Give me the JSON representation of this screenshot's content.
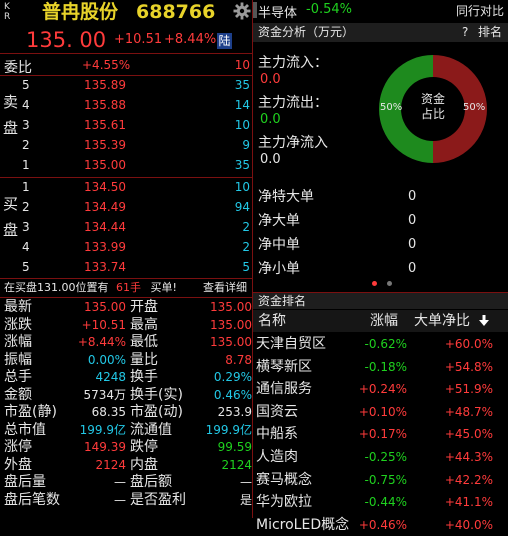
{
  "header": {
    "kr_label": "K\nR",
    "stock_name": "普冉股份",
    "stock_code": "688766",
    "price": "135. 00",
    "change": "+10.51",
    "change_pct": "+8.44%",
    "market_badge": "陆",
    "sector_name": "半导体",
    "sector_change": "-0.54%",
    "compare_label": "同行对比"
  },
  "order_book": {
    "weibi_label": "委比",
    "weibi_pct": "+4.55%",
    "weibi_val": "10",
    "sell_label": "卖\n\n盘",
    "buy_label": "买\n\n盘",
    "sells": [
      {
        "level": "5",
        "price": "135.89",
        "vol": "35"
      },
      {
        "level": "4",
        "price": "135.88",
        "vol": "14"
      },
      {
        "level": "3",
        "price": "135.61",
        "vol": "10"
      },
      {
        "level": "2",
        "price": "135.39",
        "vol": "9"
      },
      {
        "level": "1",
        "price": "135.00",
        "vol": "35"
      }
    ],
    "buys": [
      {
        "level": "1",
        "price": "134.50",
        "vol": "10"
      },
      {
        "level": "2",
        "price": "134.49",
        "vol": "94"
      },
      {
        "level": "3",
        "price": "134.44",
        "vol": "2"
      },
      {
        "level": "4",
        "price": "133.99",
        "vol": "2"
      },
      {
        "level": "5",
        "price": "133.74",
        "vol": "5"
      }
    ],
    "queue_text": "在买盘131.00位置有",
    "queue_qty": "61手",
    "queue_buy": "买单!",
    "queue_detail": "查看详细"
  },
  "quote": [
    {
      "l1": "最新",
      "v1": "135.00",
      "c1": "red",
      "l2": "开盘",
      "v2": "135.00",
      "c2": "red"
    },
    {
      "l1": "涨跌",
      "v1": "+10.51",
      "c1": "red",
      "l2": "最高",
      "v2": "135.00",
      "c2": "red"
    },
    {
      "l1": "涨幅",
      "v1": "+8.44%",
      "c1": "red",
      "l2": "最低",
      "v2": "135.00",
      "c2": "red"
    },
    {
      "l1": "振幅",
      "v1": "0.00%",
      "c1": "cyan",
      "l2": "量比",
      "v2": "8.78",
      "c2": "red"
    },
    {
      "l1": "总手",
      "v1": "4248",
      "c1": "cyan",
      "l2": "换手",
      "v2": "0.29%",
      "c2": "cyan"
    },
    {
      "l1": "金额",
      "v1": "5734万",
      "c1": "white",
      "l2": "换手(实)",
      "v2": "0.46%",
      "c2": "cyan"
    },
    {
      "l1": "市盈(静)",
      "v1": "68.35",
      "c1": "white",
      "l2": "市盈(动)",
      "v2": "253.9",
      "c2": "white"
    },
    {
      "l1": "总市值",
      "v1": "199.9亿",
      "c1": "cyan",
      "l2": "流通值",
      "v2": "199.9亿",
      "c2": "cyan"
    },
    {
      "l1": "涨停",
      "v1": "149.39",
      "c1": "red",
      "l2": "跌停",
      "v2": "99.59",
      "c2": "green"
    },
    {
      "l1": "外盘",
      "v1": "2124",
      "c1": "red",
      "l2": "内盘",
      "v2": "2124",
      "c2": "green"
    },
    {
      "l1": "盘后量",
      "v1": "—",
      "c1": "white",
      "l2": "盘后额",
      "v2": "—",
      "c2": "white"
    },
    {
      "l1": "盘后笔数",
      "v1": "—",
      "c1": "white",
      "l2": "是否盈利",
      "v2": "是",
      "c2": "white"
    }
  ],
  "fund": {
    "title": "资金分析（万元）",
    "help": "?",
    "rank": "排名",
    "inflow_label": "主力流入：",
    "inflow_val": "0.0",
    "outflow_label": "主力流出：",
    "outflow_val": "0.0",
    "net_label": "主力净流入",
    "net_val": "0.0",
    "donut_center": "资金\n占比",
    "donut_left_pct": "50%",
    "donut_right_pct": "50%",
    "donut_left_share": 0.5,
    "colors": {
      "inflow": "#8b1a1a",
      "outflow": "#1e8a1e"
    },
    "nets": [
      {
        "label": "净特大单",
        "val": "0"
      },
      {
        "label": "净大单",
        "val": "0"
      },
      {
        "label": "净中单",
        "val": "0"
      },
      {
        "label": "净小单",
        "val": "0"
      }
    ]
  },
  "rank": {
    "title": "资金排名",
    "col_name": "名称",
    "col_change": "涨幅",
    "col_net": "大单净比",
    "rows": [
      {
        "name": "天津自贸区",
        "chg": "-0.62%",
        "chg_c": "green",
        "net": "+60.0%"
      },
      {
        "name": "横琴新区",
        "chg": "-0.18%",
        "chg_c": "green",
        "net": "+54.8%"
      },
      {
        "name": "通信服务",
        "chg": "+0.24%",
        "chg_c": "red",
        "net": "+51.9%"
      },
      {
        "name": "国资云",
        "chg": "+0.10%",
        "chg_c": "red",
        "net": "+48.7%"
      },
      {
        "name": "中船系",
        "chg": "+0.17%",
        "chg_c": "red",
        "net": "+45.0%"
      },
      {
        "name": "人造肉",
        "chg": "-0.25%",
        "chg_c": "green",
        "net": "+44.3%"
      },
      {
        "name": "赛马概念",
        "chg": "-0.75%",
        "chg_c": "green",
        "net": "+42.2%"
      },
      {
        "name": "华为欧拉",
        "chg": "-0.44%",
        "chg_c": "green",
        "net": "+41.1%"
      },
      {
        "name": "MicroLED概念",
        "chg": "+0.46%",
        "chg_c": "red",
        "net": "+40.0%"
      }
    ]
  }
}
